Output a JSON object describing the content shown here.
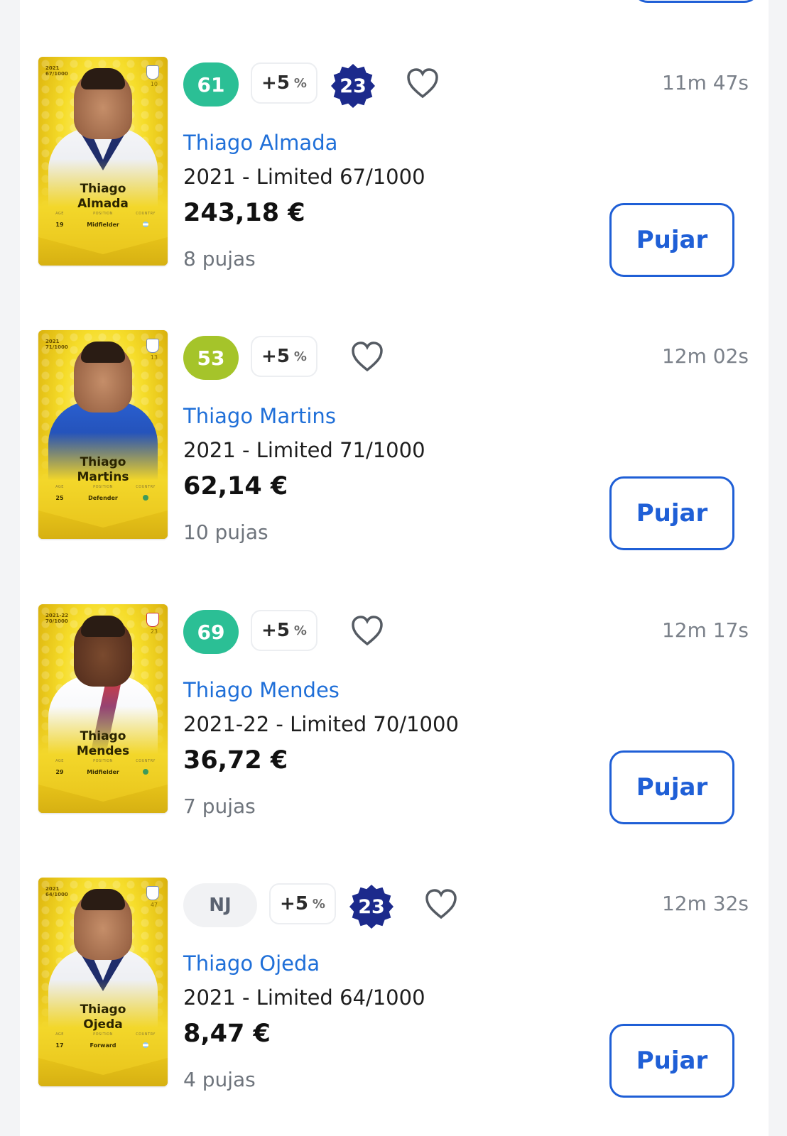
{
  "bid_label": "Pujar",
  "colors": {
    "accent": "#1f5fd6",
    "score_green": "#2bbf95",
    "score_lime": "#a5c42a",
    "badge_navy": "#1c2a8c"
  },
  "listings": [
    {
      "score": "61",
      "score_color": "#2bbf95",
      "bonus": "+5",
      "bonus_unit": "%",
      "rank_badge": "23",
      "time_left": "11m 47s",
      "player_name": "Thiago Almada",
      "edition": "2021 - Limited 67/1000",
      "price": "243,18 €",
      "bids": "8 pujas",
      "card": {
        "season": "2021",
        "serial": "67/1000",
        "number": "10",
        "first": "Thiago",
        "last": "Almada",
        "age_label": "AGE",
        "age": "19",
        "position_label": "POSITION",
        "position": "Midfielder",
        "country_label": "COUNTRY"
      }
    },
    {
      "score": "53",
      "score_color": "#a5c42a",
      "bonus": "+5",
      "bonus_unit": "%",
      "time_left": "12m 02s",
      "player_name": "Thiago Martins",
      "edition": "2021 - Limited 71/1000",
      "price": "62,14 €",
      "bids": "10 pujas",
      "card": {
        "season": "2021",
        "serial": "71/1000",
        "number": "13",
        "first": "Thiago",
        "last": "Martins",
        "age_label": "AGE",
        "age": "25",
        "position_label": "POSITION",
        "position": "Defender",
        "country_label": "COUNTRY"
      }
    },
    {
      "score": "69",
      "score_color": "#2bbf95",
      "bonus": "+5",
      "bonus_unit": "%",
      "time_left": "12m 17s",
      "player_name": "Thiago Mendes",
      "edition": "2021-22 - Limited 70/1000",
      "price": "36,72 €",
      "bids": "7 pujas",
      "card": {
        "season": "2021-22",
        "serial": "70/1000",
        "number": "23",
        "first": "Thiago",
        "last": "Mendes",
        "age_label": "AGE",
        "age": "29",
        "position_label": "POSITION",
        "position": "Midfielder",
        "country_label": "COUNTRY"
      }
    },
    {
      "score": "NJ",
      "score_color": "#f1f2f4",
      "bonus": "+5",
      "bonus_unit": "%",
      "rank_badge": "23",
      "time_left": "12m 32s",
      "player_name": "Thiago Ojeda",
      "edition": "2021 - Limited 64/1000",
      "price": "8,47 €",
      "bids": "4 pujas",
      "card": {
        "season": "2021",
        "serial": "64/1000",
        "number": "47",
        "first": "Thiago",
        "last": "Ojeda",
        "age_label": "AGE",
        "age": "17",
        "position_label": "POSITION",
        "position": "Forward",
        "country_label": "COUNTRY"
      }
    }
  ]
}
